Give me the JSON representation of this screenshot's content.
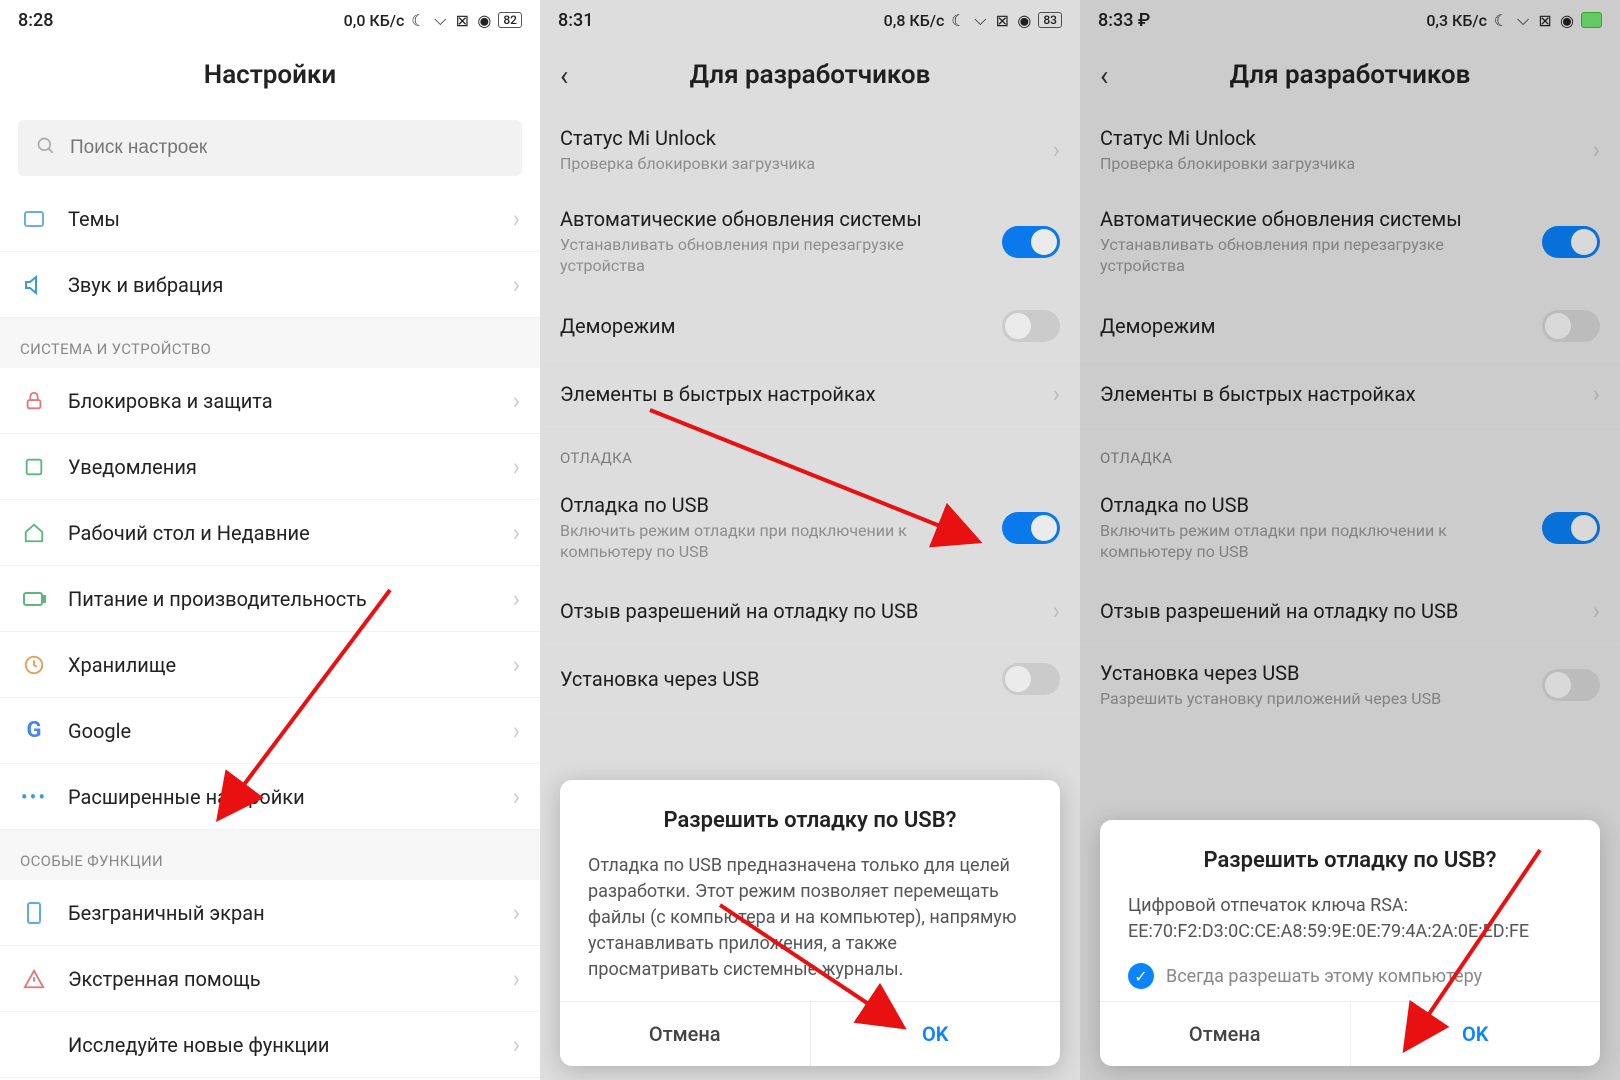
{
  "screen1": {
    "time": "8:28",
    "net": "0,0 КБ/с",
    "batt": "82",
    "title": "Настройки",
    "search_placeholder": "Поиск настроек",
    "items": {
      "themes": "Темы",
      "sound": "Звук и вибрация"
    },
    "sec_system": "СИСТЕМА И УСТРОЙСТВО",
    "sys_items": {
      "lock": "Блокировка и защита",
      "notif": "Уведомления",
      "home": "Рабочий стол и Недавние",
      "power": "Питание и производительность",
      "storage": "Хранилище",
      "google": "Google",
      "advanced": "Расширенные настройки"
    },
    "sec_special": "ОСОБЫЕ ФУНКЦИИ",
    "sp_items": {
      "fullscreen": "Безграничный экран",
      "emergency": "Экстренная помощь",
      "explore": "Исследуйте новые функции"
    }
  },
  "screen2": {
    "time": "8:31",
    "net": "0,8 КБ/с",
    "batt": "83",
    "title": "Для разработчиков",
    "mi_unlock": "Статус Mi Unlock",
    "mi_unlock_desc": "Проверка блокировки загрузчика",
    "auto_update": "Автоматические обновления системы",
    "auto_update_desc": "Устанавливать обновления при перезагрузке устройства",
    "demo": "Деморежим",
    "qs": "Элементы в быстрых настройках",
    "sec_debug": "ОТЛАДКА",
    "usb_debug": "Отладка по USB",
    "usb_debug_desc": "Включить режим отладки при подключении к компьютеру по USB",
    "revoke": "Отзыв разрешений на отладку по USB",
    "install_usb": "Установка через USB",
    "dialog": {
      "title": "Разрешить отладку по USB?",
      "body": "Отладка по USB предназначена только для целей разработки. Этот режим позволяет перемещать файлы (с компьютера и на компьютер), напрямую устанавливать приложения, а также просматривать системные журналы.",
      "cancel": "Отмена",
      "ok": "OK"
    }
  },
  "screen3": {
    "time": "8:33",
    "net": "0,3 КБ/с",
    "batt": "",
    "title": "Для разработчиков",
    "mi_unlock": "Статус Mi Unlock",
    "mi_unlock_desc": "Проверка блокировки загрузчика",
    "auto_update": "Автоматические обновления системы",
    "auto_update_desc": "Устанавливать обновления при перезагрузке устройства",
    "demo": "Деморежим",
    "qs": "Элементы в быстрых настройках",
    "sec_debug": "ОТЛАДКА",
    "usb_debug": "Отладка по USB",
    "usb_debug_desc": "Включить режим отладки при подключении к компьютеру по USB",
    "revoke": "Отзыв разрешений на отладку по USB",
    "install_usb": "Установка через USB",
    "install_usb_desc": "Разрешить установку приложений через USB",
    "dialog": {
      "title": "Разрешить отладку по USB?",
      "body1": "Цифровой отпечаток ключа RSA:",
      "body2": "EE:70:F2:D3:0C:CE:A8:59:9E:0E:79:4A:2A:0E:ED:FE",
      "checkbox": "Всегда разрешать этому компьютеру",
      "cancel": "Отмена",
      "ok": "OK"
    }
  }
}
